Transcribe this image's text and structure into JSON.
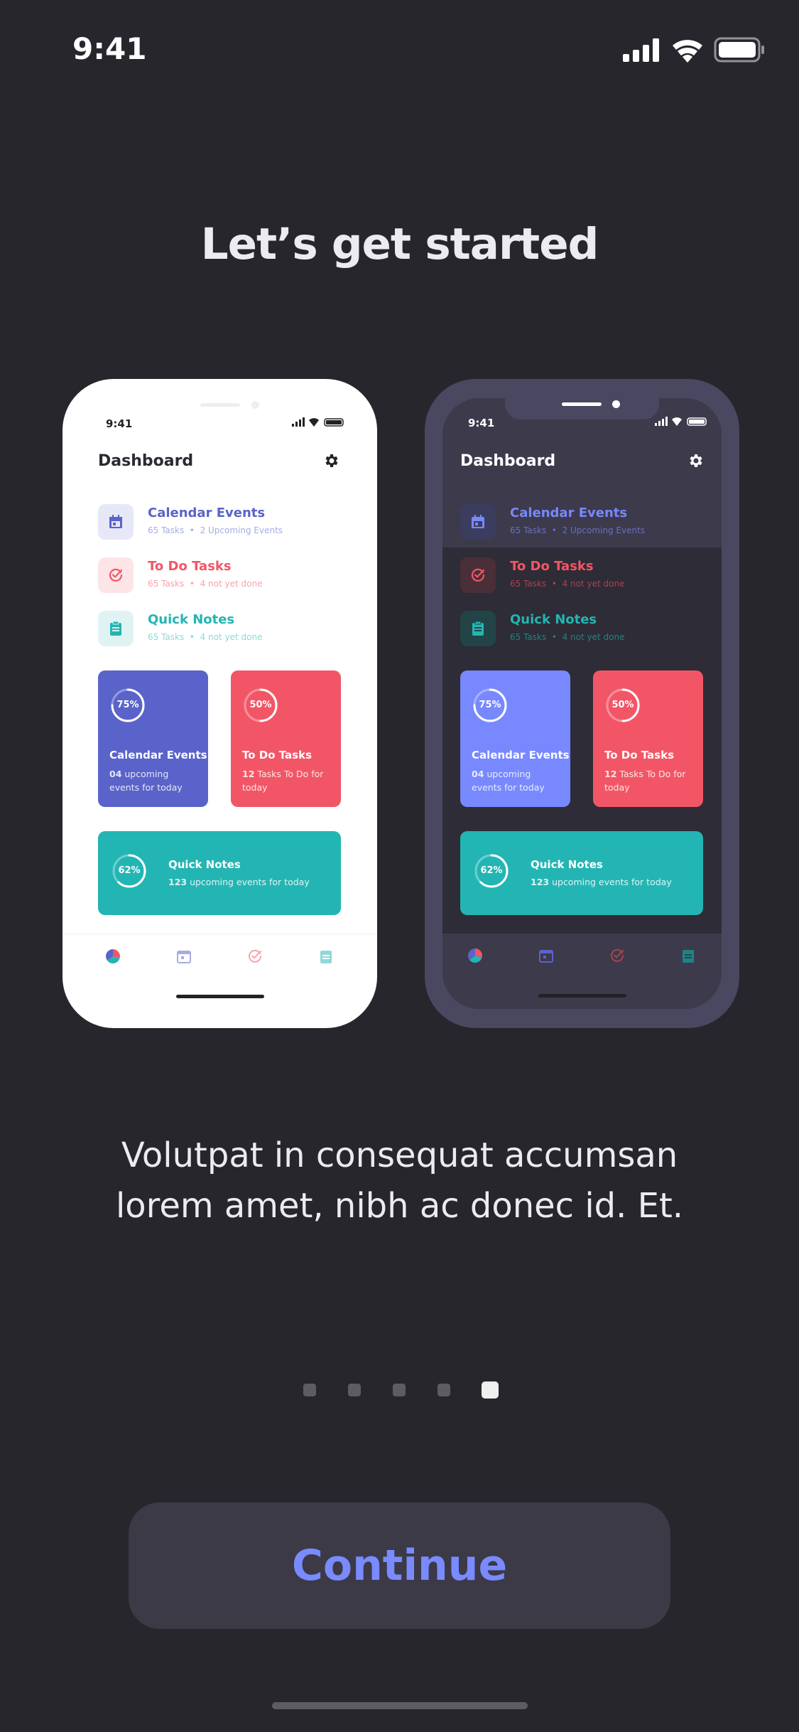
{
  "status_bar": {
    "time": "9:41"
  },
  "headline": "Let’s get started",
  "colors": {
    "background": "#26262c",
    "calendar": "#5a63c9",
    "calendar_dark": "#7888ff",
    "todo": "#f25666",
    "notes": "#23b5b3",
    "continue_text": "#7a8aff"
  },
  "phones": [
    {
      "theme": "light",
      "time": "9:41",
      "title": "Dashboard",
      "rows": [
        {
          "title": "Calendar Events",
          "sub_count": "65 Tasks",
          "sub_detail": "2 Upcoming Events",
          "icon": "calendar-icon"
        },
        {
          "title": "To Do Tasks",
          "sub_count": "65 Tasks",
          "sub_detail": "4 not yet done",
          "icon": "check-circle-icon"
        },
        {
          "title": "Quick Notes",
          "sub_count": "65 Tasks",
          "sub_detail": "4 not yet done",
          "icon": "clipboard-icon"
        }
      ],
      "cards": [
        {
          "percent": 75,
          "percent_label": "75%",
          "title": "Calendar Events",
          "bold": "04",
          "sub": " upcoming events for today"
        },
        {
          "percent": 50,
          "percent_label": "50%",
          "title": "To Do Tasks",
          "bold": "12",
          "sub": " Tasks To Do for today"
        },
        {
          "percent": 62,
          "percent_label": "62%",
          "title": "Quick Notes",
          "bold": "123",
          "sub": " upcoming events for today"
        }
      ]
    },
    {
      "theme": "dark",
      "time": "9:41",
      "title": "Dashboard",
      "rows": [
        {
          "title": "Calendar Events",
          "sub_count": "65 Tasks",
          "sub_detail": "2 Upcoming Events",
          "icon": "calendar-icon"
        },
        {
          "title": "To Do Tasks",
          "sub_count": "65 Tasks",
          "sub_detail": "4 not yet done",
          "icon": "check-circle-icon"
        },
        {
          "title": "Quick Notes",
          "sub_count": "65 Tasks",
          "sub_detail": "4 not yet done",
          "icon": "clipboard-icon"
        }
      ],
      "cards": [
        {
          "percent": 75,
          "percent_label": "75%",
          "title": "Calendar Events",
          "bold": "04",
          "sub": " upcoming events for today"
        },
        {
          "percent": 50,
          "percent_label": "50%",
          "title": "To Do Tasks",
          "bold": "12",
          "sub": " Tasks To Do for today"
        },
        {
          "percent": 62,
          "percent_label": "62%",
          "title": "Quick Notes",
          "bold": "123",
          "sub": " upcoming events for today"
        }
      ]
    }
  ],
  "body_text_line1": "Volutpat in consequat accumsan",
  "body_text_line2": "lorem amet, nibh ac donec id. Et.",
  "pagination": {
    "total": 5,
    "active_index": 4
  },
  "continue_label": "Continue"
}
